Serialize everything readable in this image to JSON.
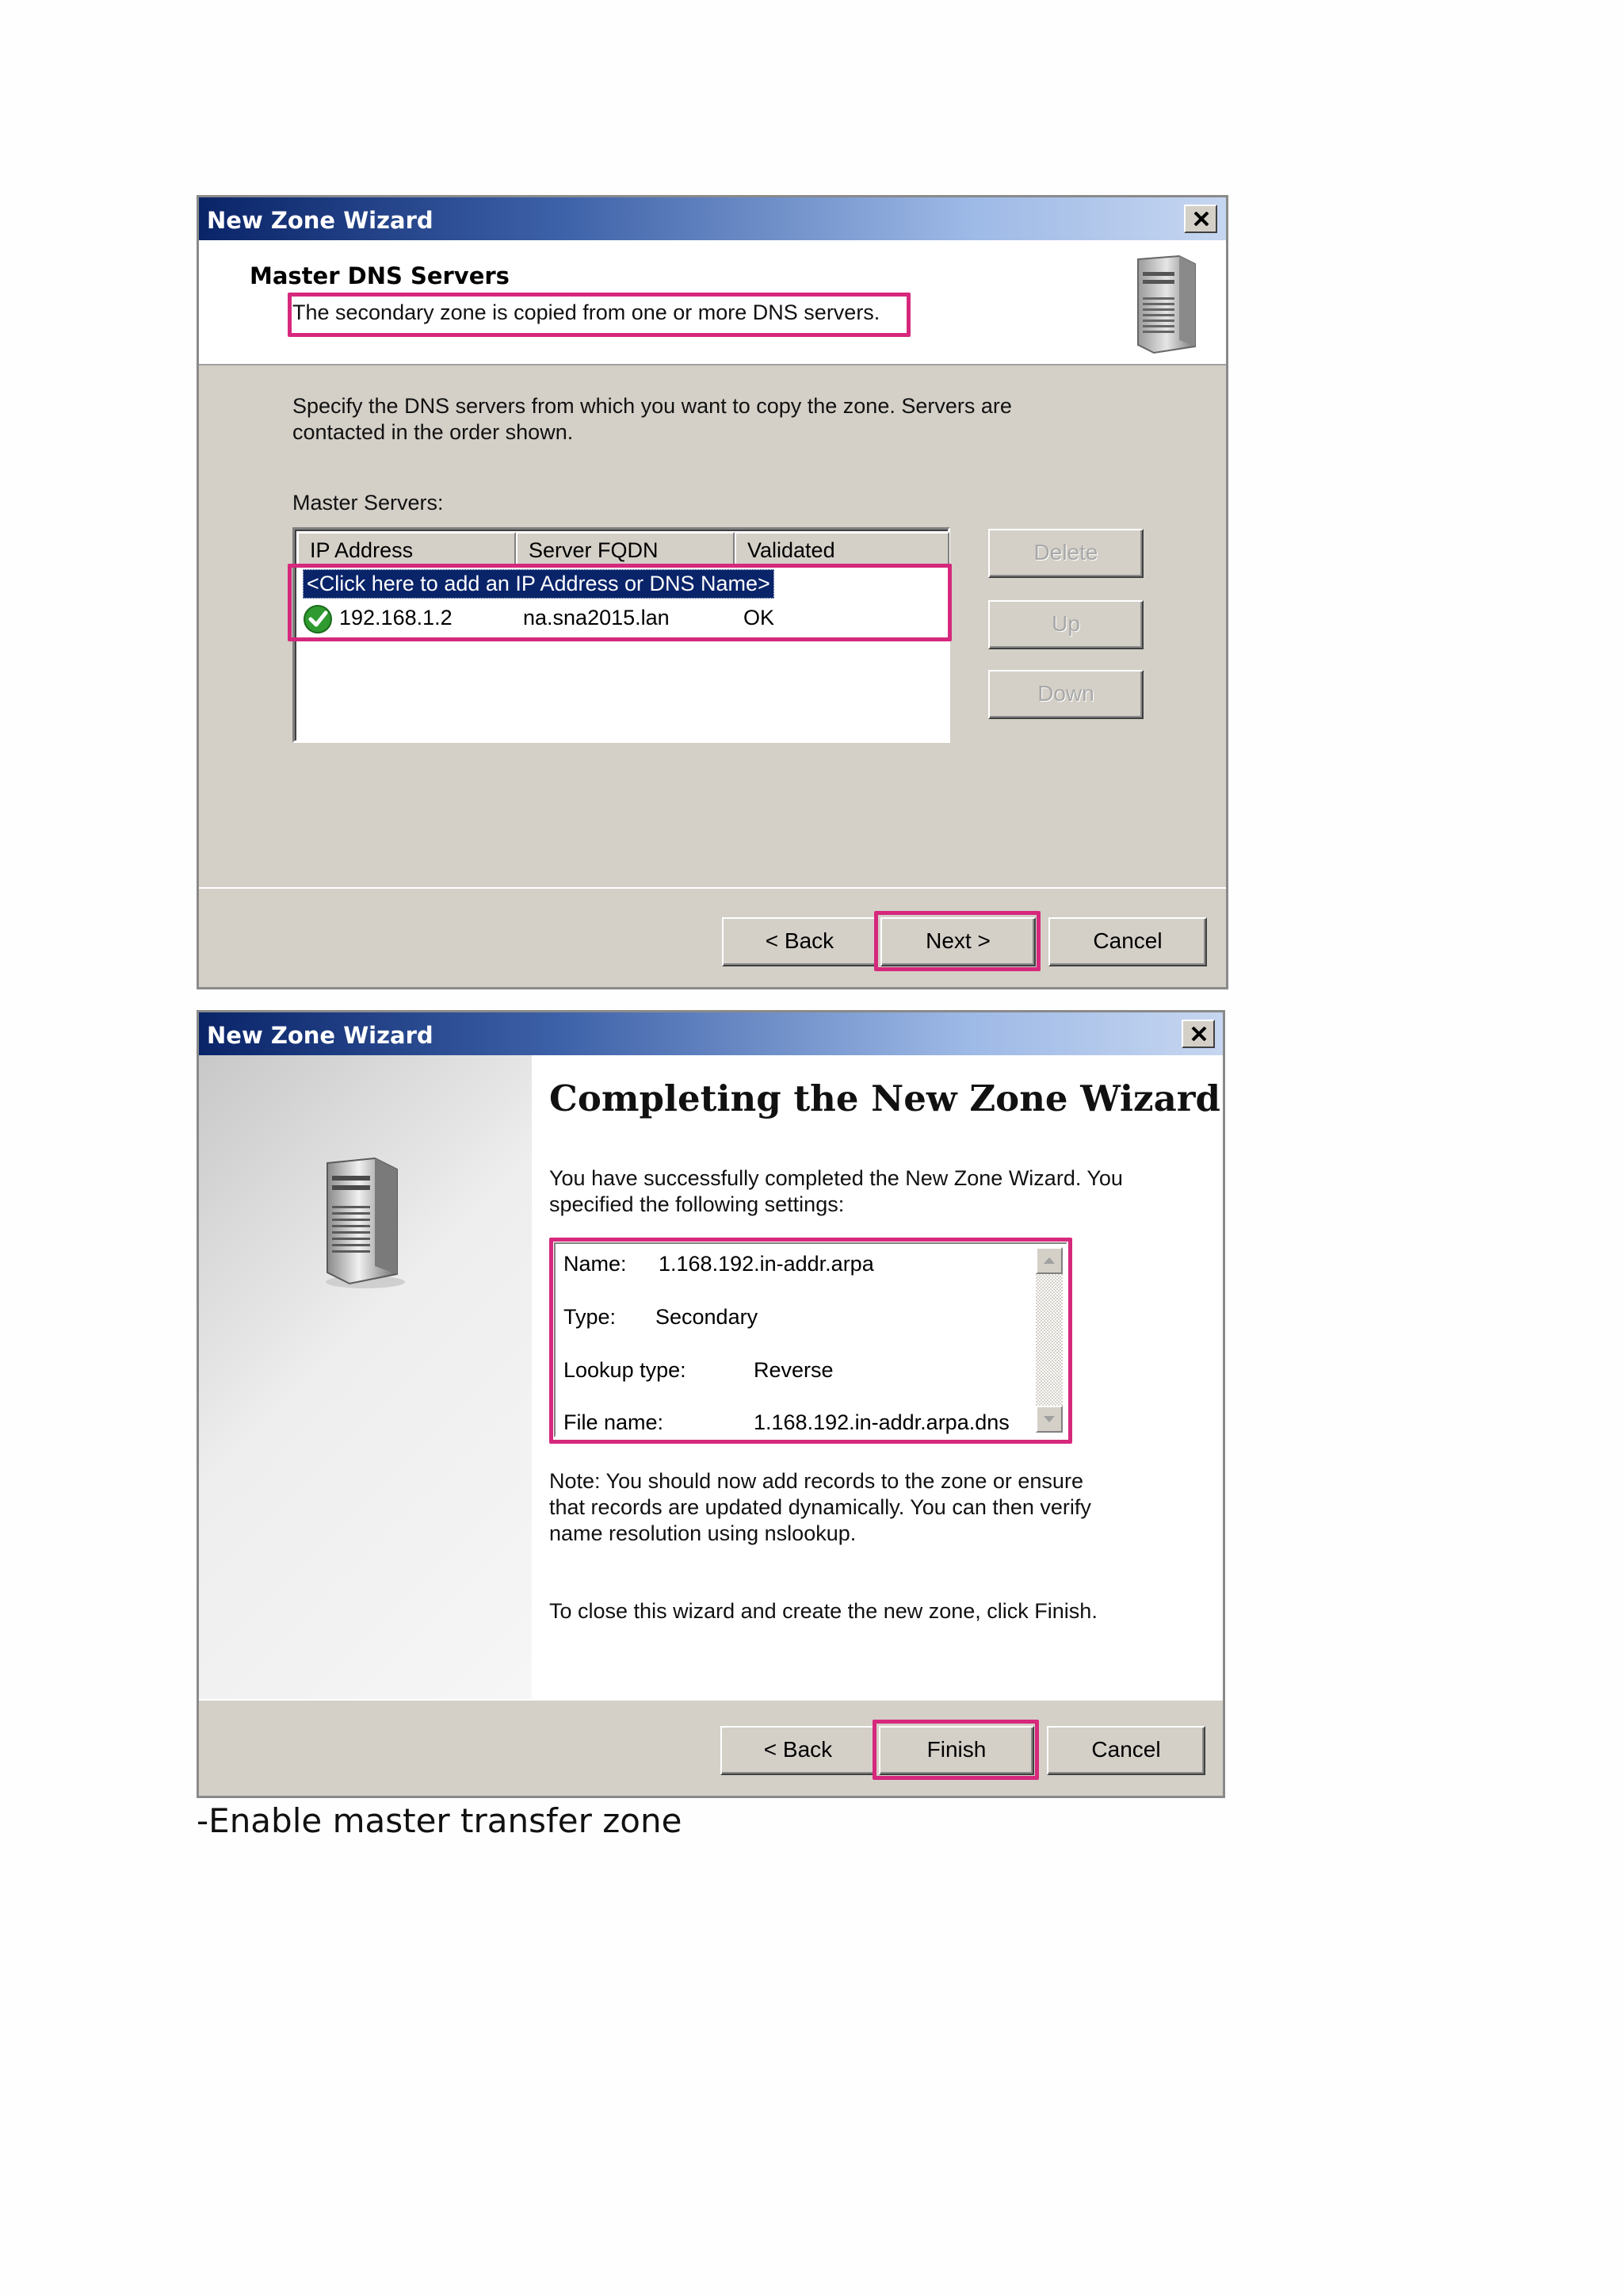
{
  "window1": {
    "title": "New Zone Wizard",
    "header_title": "Master DNS Servers",
    "header_subtitle": "The secondary zone is copied from one or more DNS servers.",
    "instructions_line1": "Specify the DNS servers from which you want to copy the zone.  Servers are",
    "instructions_line2": "contacted in the order shown.",
    "list_label": "Master Servers:",
    "columns": [
      "IP Address",
      "Server FQDN",
      "Validated"
    ],
    "add_row_text": "<Click here to add an IP Address or DNS Name>",
    "rows": [
      {
        "ip": "192.168.1.2",
        "fqdn": "na.sna2015.lan",
        "validated": "OK",
        "status_icon": "check-circle-icon"
      }
    ],
    "side_buttons": {
      "delete": "Delete",
      "up": "Up",
      "down": "Down"
    },
    "footer_buttons": {
      "back": "< Back",
      "next": "Next >",
      "cancel": "Cancel"
    }
  },
  "window2": {
    "title": "New Zone Wizard",
    "heading": "Completing the New Zone Wizard",
    "intro_line1": "You have successfully completed the New Zone Wizard. You",
    "intro_line2": "specified the following settings:",
    "summary": {
      "name_label": "Name:",
      "name_value": "1.168.192.in-addr.arpa",
      "type_label": "Type:",
      "type_value": "Secondary",
      "lookup_label": "Lookup type:",
      "lookup_value": "Reverse",
      "file_label": "File name:",
      "file_value": "1.168.192.in-addr.arpa.dns"
    },
    "note_line1": "Note: You should now add records to the zone or ensure",
    "note_line2": "that records are updated dynamically. You can then verify",
    "note_line3": "name resolution using nslookup.",
    "close_text": "To close this wizard and create the new zone, click Finish.",
    "footer_buttons": {
      "back": "< Back",
      "finish": "Finish",
      "cancel": "Cancel"
    }
  },
  "caption": "-Enable master transfer zone",
  "colors": {
    "highlight": "#d6287c",
    "title_dark": "#0a2468",
    "selection": "#0a246a"
  }
}
